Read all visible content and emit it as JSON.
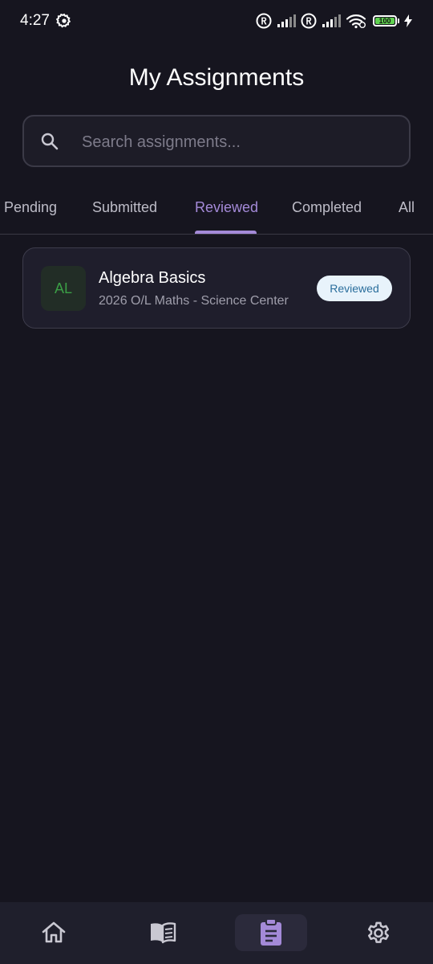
{
  "status_bar": {
    "time": "4:27",
    "battery": "100",
    "icons": [
      "gear-icon",
      "registered-icon",
      "signal-icon",
      "registered-icon",
      "signal-icon",
      "wifi-icon",
      "battery-icon",
      "charging-icon"
    ]
  },
  "page": {
    "title": "My Assignments"
  },
  "search": {
    "placeholder": "Search assignments...",
    "value": ""
  },
  "tabs": [
    {
      "label": "Pending"
    },
    {
      "label": "Submitted"
    },
    {
      "label": "Reviewed",
      "active": true
    },
    {
      "label": "Completed"
    },
    {
      "label": "All"
    }
  ],
  "assignments": [
    {
      "initials": "AL",
      "title": "Algebra Basics",
      "subtitle": "2026 O/L Maths - Science Center",
      "status": "Reviewed"
    }
  ],
  "bottom_nav": {
    "items": [
      {
        "icon": "home-icon"
      },
      {
        "icon": "book-icon"
      },
      {
        "icon": "clipboard-icon",
        "active": true
      },
      {
        "icon": "gear-icon"
      }
    ]
  },
  "colors": {
    "background": "#16151f",
    "accent": "#a48ad8",
    "card": "#1f1e2c",
    "badge_bg": "#e8f3fb",
    "badge_text": "#2a6e9c",
    "avatar_text": "#3b9e46"
  }
}
